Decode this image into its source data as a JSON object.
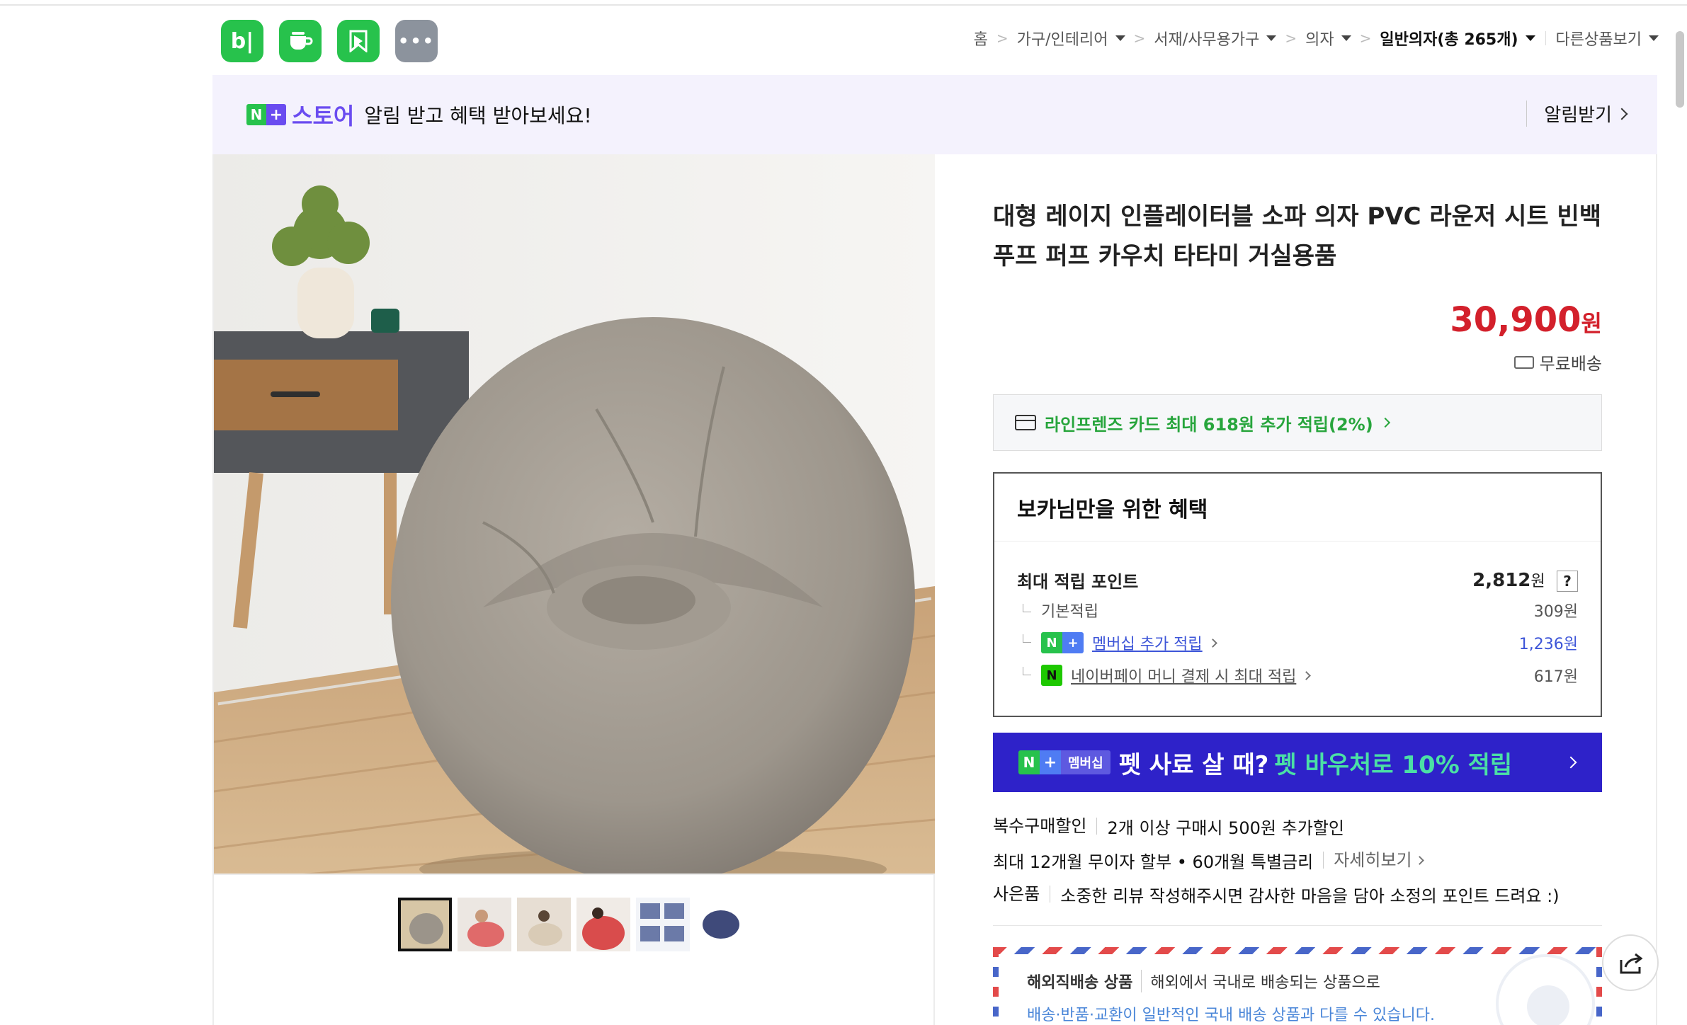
{
  "header": {
    "apps": [
      {
        "label": "b|",
        "icon": "blog-icon",
        "color": "#27c24c"
      },
      {
        "label": "",
        "icon": "cafe-cup-icon",
        "color": "#27c24c"
      },
      {
        "label": "",
        "icon": "bookmark-icon",
        "color": "#27c24c"
      },
      {
        "label": "•••",
        "icon": "more-icon",
        "color": "#8c939d"
      }
    ],
    "breadcrumb": [
      {
        "label": "홈",
        "dropdown": false
      },
      {
        "label": "가구/인테리어",
        "dropdown": true
      },
      {
        "label": "서재/사무용가구",
        "dropdown": true
      },
      {
        "label": "의자",
        "dropdown": true
      },
      {
        "label": "일반의자(총 265개)",
        "dropdown": true
      }
    ],
    "other_products": "다른상품보기"
  },
  "store_banner": {
    "badge_n": "N",
    "badge_plus": "+",
    "store_word": "스토어",
    "message": "알림 받고 혜택 받아보세요!",
    "notify_label": "알림받기"
  },
  "product": {
    "title": "대형 레이지 인플레이터블 소파 의자 PVC 라운저 시트 빈백 푸프 퍼프 카우치 타타미 거실용품",
    "price": "30,900",
    "price_unit": "원",
    "shipping": "무료배송",
    "card_promo": "라인프렌즈 카드 최대 618원 추가 적립(2%)",
    "benefits": {
      "heading": "보카님만을 위한 혜택",
      "max_points_label": "최대 적립 포인트",
      "max_points_value": "2,812",
      "max_points_unit": "원",
      "help": "?",
      "base_label": "기본적립",
      "base_value": "309원",
      "membership_label": "멤버십 추가 적립",
      "membership_value": "1,236원",
      "npay_label": "네이버페이 머니 결제 시 최대 적립",
      "npay_value": "617원"
    },
    "pet_banner": {
      "tag_n": "N",
      "tag_plus": "+",
      "tag_text": "멤버십",
      "text": "펫 사료 살 때?",
      "accent": "펫 바우처로 10% 적립"
    },
    "extras": {
      "multi_label": "복수구매할인",
      "multi_text": "2개 이상 구매시 500원 추가할인",
      "installment_text": "최대 12개월 무이자 할부 • 60개월 특별금리",
      "installment_link": "자세히보기",
      "gift_label": "사은품",
      "gift_text": "소중한 리뷰 작성해주시면 감사한 마음을 담아 소정의 포인트 드려요 :)"
    },
    "overseas": {
      "label": "해외직배송 상품",
      "line1": "해외에서 국내로 배송되는 상품으로",
      "line2": "배송·반품·교환이 일반적인 국내 배송 상품과 다를 수 있습니다."
    }
  },
  "gallery": {
    "thumbnail_count": 6,
    "selected_index": 0
  },
  "colors": {
    "brand_green": "#27c24c",
    "store_purple": "#6a4cf0",
    "price_red": "#d3202b",
    "pet_banner_bg": "#2e22c9",
    "membership_blue": "#3d55d8"
  }
}
